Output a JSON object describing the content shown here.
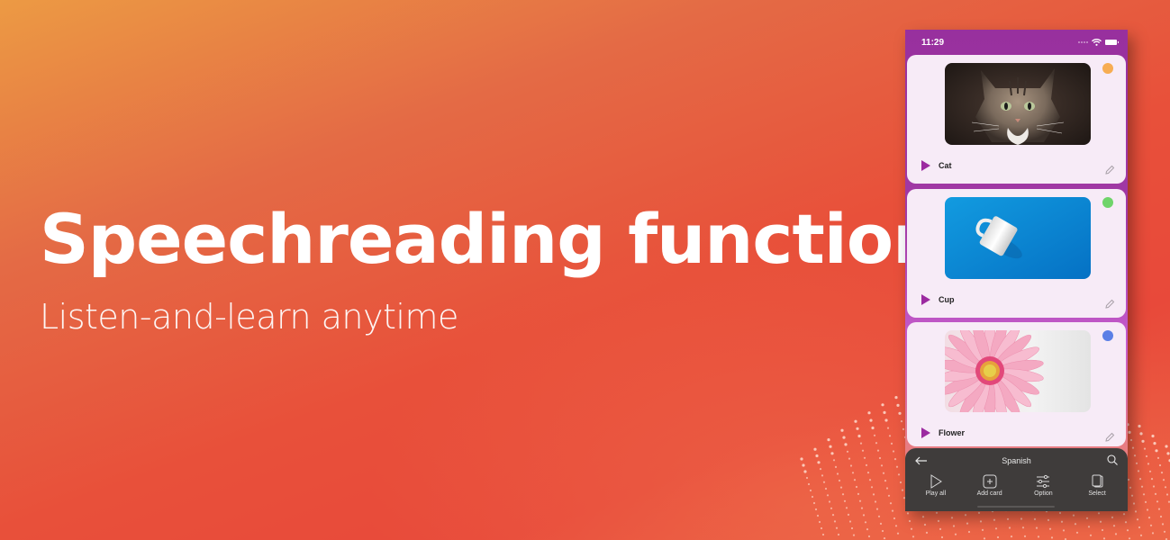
{
  "banner": {
    "headline": "Speechreading function",
    "subline": "Listen-and-learn anytime"
  },
  "phone": {
    "status_bar": {
      "time": "11:29",
      "icons": [
        "signal-dots-icon",
        "wifi-icon",
        "battery-icon"
      ]
    },
    "cards": [
      {
        "label": "Cat",
        "image": "cat-photo",
        "dot_color": "#f7ad52",
        "icons": [
          "play-icon",
          "pencil-icon"
        ]
      },
      {
        "label": "Cup",
        "image": "cup-photo",
        "dot_color": "#6fd46a",
        "icons": [
          "play-icon",
          "pencil-icon"
        ]
      },
      {
        "label": "Flower",
        "image": "flower-photo",
        "dot_color": "#5b7fe6",
        "icons": [
          "play-icon",
          "pencil-icon"
        ]
      }
    ],
    "toolbar": {
      "title": "Spanish",
      "back_icon": "arrow-left-icon",
      "search_icon": "search-icon",
      "actions": [
        {
          "label": "Play all",
          "icon": "play-outline-icon"
        },
        {
          "label": "Add card",
          "icon": "add-square-icon"
        },
        {
          "label": "Option",
          "icon": "sliders-icon"
        },
        {
          "label": "Select",
          "icon": "stack-pages-icon"
        }
      ]
    }
  },
  "colors": {
    "accent_purple": "#9c2aa0",
    "card_bg": "#f7ebf7",
    "toolbar_bg": "#3f3c3b",
    "bg_orange": "#ec9a44",
    "bg_red": "#e8493a"
  }
}
